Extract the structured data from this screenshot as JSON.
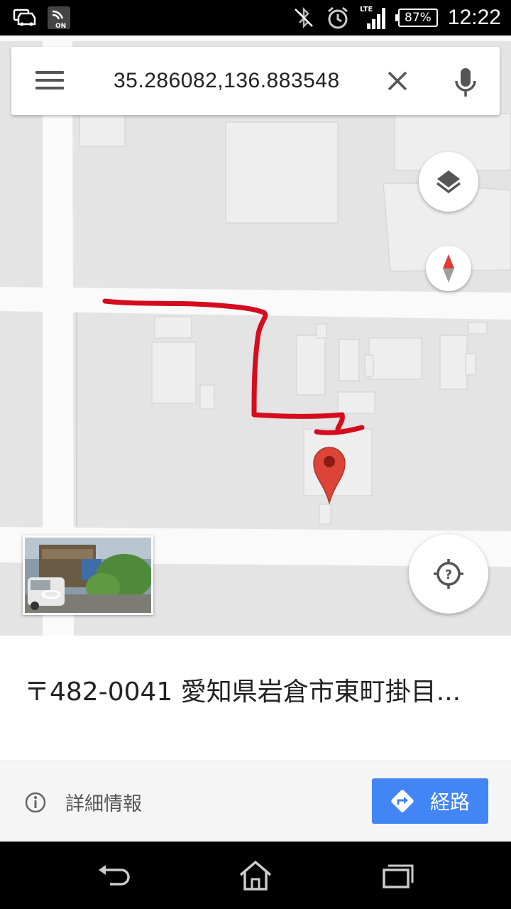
{
  "status_bar": {
    "battery_percent": "87%",
    "network": "LTE",
    "time": "12:22",
    "icons": [
      "car-notification-icon",
      "nfc-on-icon",
      "bluetooth-off-icon",
      "alarm-icon",
      "signal-icon",
      "battery-icon"
    ]
  },
  "search": {
    "query": "35.286082,136.883548"
  },
  "map": {
    "pin_color": "#db4437",
    "annotation_color": "#d50c1e"
  },
  "place": {
    "address": "〒482-0041 愛知県岩倉市東町掛目..."
  },
  "actions": {
    "details_label": "詳細情報",
    "route_label": "経路",
    "route_color": "#4285f4"
  },
  "nav_bar": {
    "buttons": [
      "back-icon",
      "home-icon",
      "recents-icon"
    ]
  }
}
